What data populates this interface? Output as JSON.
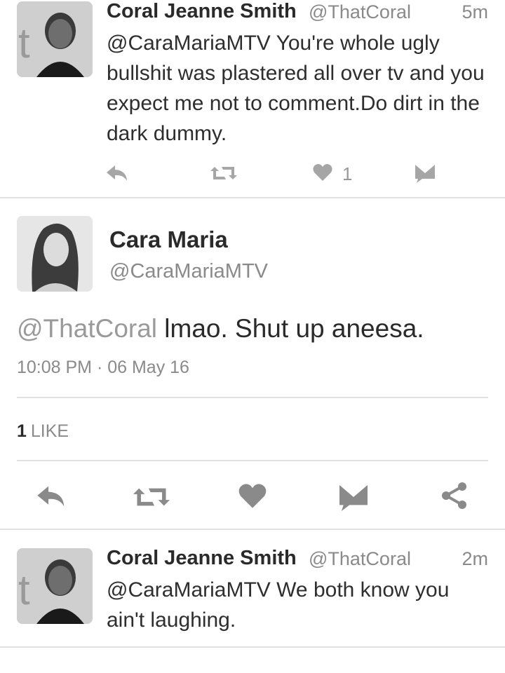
{
  "tweet1": {
    "name": "Coral Jeanne Smith",
    "handle": "@ThatCoral",
    "time": "5m",
    "text": "@CaraMariaMTV You're whole ugly bullshit was plastered all over tv and you expect me not to comment.Do dirt in the dark dummy.",
    "like_count": "1"
  },
  "focused": {
    "name": "Cara Maria",
    "handle": "@CaraMariaMTV",
    "mention": "@ThatCoral",
    "text": " lmao. Shut up aneesa.",
    "timestamp": "10:08 PM · 06 May 16",
    "like_count": "1",
    "like_label": "LIKE"
  },
  "tweet2": {
    "name": "Coral Jeanne Smith",
    "handle": "@ThatCoral",
    "time": "2m",
    "text": "@CaraMariaMTV We both know you ain't laughing."
  },
  "icons": {
    "reply": "reply-icon",
    "retweet": "retweet-icon",
    "like": "heart-icon",
    "dm": "envelope-icon",
    "share": "share-icon"
  }
}
